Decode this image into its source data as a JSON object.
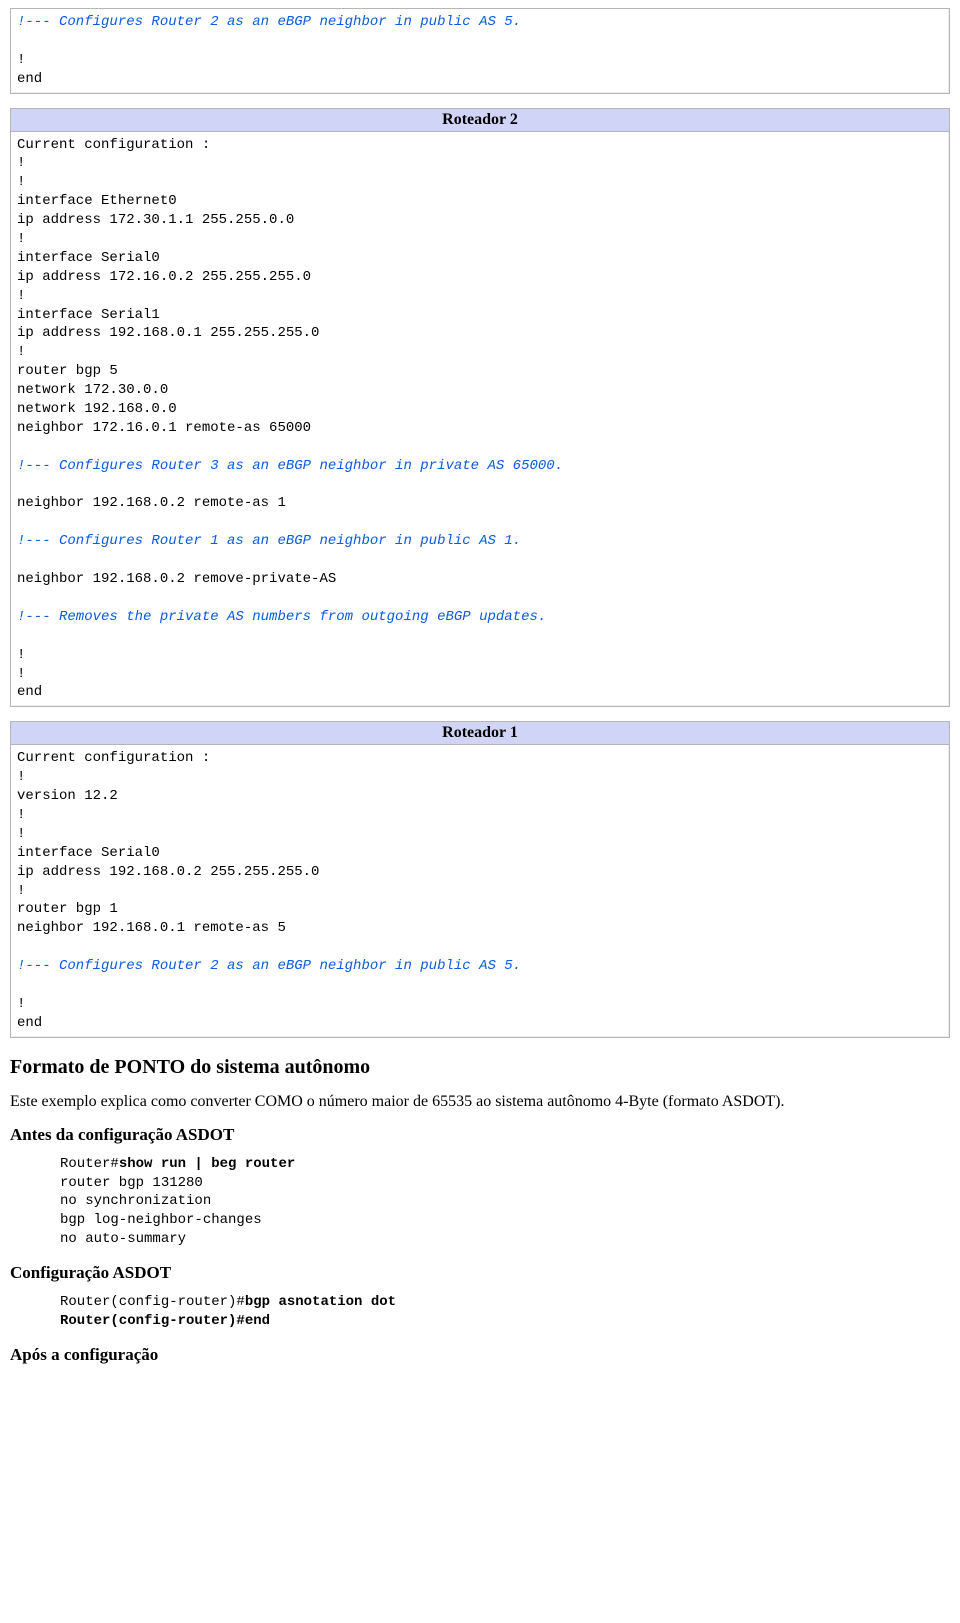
{
  "box_top": {
    "line1": "!--- Configures Router 2 as an eBGP neighbor in public AS 5.",
    "line2": "",
    "line3": "!",
    "line4": "end"
  },
  "box_r2": {
    "title": "Roteador 2",
    "seg1": "Current configuration :\n!\n!\ninterface Ethernet0\nip address 172.30.1.1 255.255.0.0\n!\ninterface Serial0\nip address 172.16.0.2 255.255.255.0\n!\ninterface Serial1\nip address 192.168.0.1 255.255.255.0\n!\nrouter bgp 5\nnetwork 172.30.0.0\nnetwork 192.168.0.0\nneighbor 172.16.0.1 remote-as 65000",
    "c1": "!--- Configures Router 3 as an eBGP neighbor in private AS 65000.",
    "seg2": "neighbor 192.168.0.2 remote-as 1",
    "c2": "!--- Configures Router 1 as an eBGP neighbor in public AS 1.",
    "seg3": "neighbor 192.168.0.2 remove-private-AS",
    "c3": "!--- Removes the private AS numbers from outgoing eBGP updates.",
    "seg4": "!\n!\nend"
  },
  "box_r1": {
    "title": "Roteador 1",
    "seg1": "Current configuration :\n!\nversion 12.2\n!\n!\ninterface Serial0\nip address 192.168.0.2 255.255.255.0\n!\nrouter bgp 1\nneighbor 192.168.0.1 remote-as 5",
    "c1": "!--- Configures Router 2 as an eBGP neighbor in public AS 5.",
    "seg2": "!\nend"
  },
  "headings": {
    "h2_asdot": "Formato de PONTO do sistema autônomo",
    "h3_before": "Antes da configuração ASDOT",
    "h3_config": "Configuração ASDOT",
    "h3_after": "Após a configuração"
  },
  "paragraphs": {
    "p1": "Este exemplo explica como converter COMO o número maior de 65535 ao sistema autônomo 4-Byte (formato ASDOT)."
  },
  "cli_before": {
    "prompt": "Router#",
    "cmd": "show run | beg router",
    "body": "router bgp 131280\nno synchronization\nbgp log-neighbor-changes\nno auto-summary"
  },
  "cli_config": {
    "line1_prompt": "Router(config-router)#",
    "line1_cmd": "bgp asnotation dot",
    "line2": "Router(config-router)#end"
  }
}
